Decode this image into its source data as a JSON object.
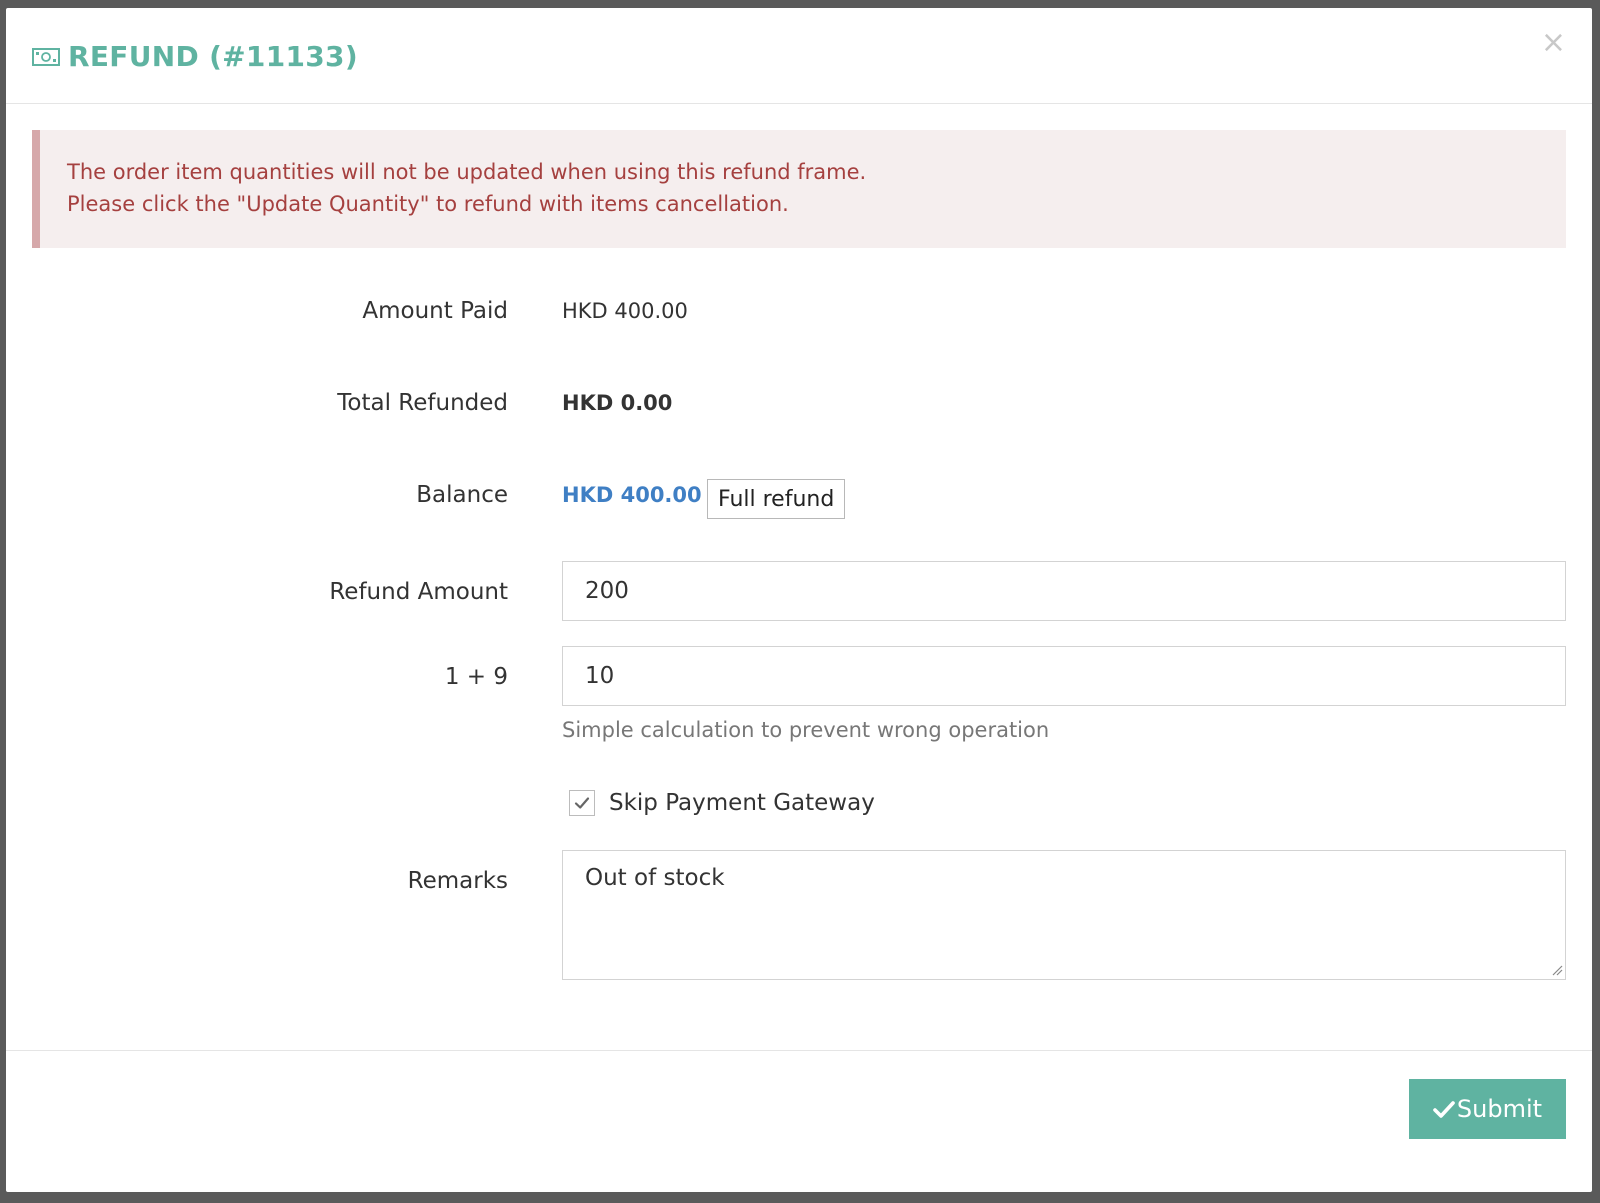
{
  "modal": {
    "title": "REFUND (#11133)",
    "close_label": "×"
  },
  "alert": {
    "line1": "The order item quantities will not be updated when using this refund frame.",
    "line2": "Please click the \"Update Quantity\" to refund with items cancellation."
  },
  "form": {
    "amount_paid": {
      "label": "Amount Paid",
      "value": "HKD 400.00"
    },
    "total_refunded": {
      "label": "Total Refunded",
      "value": "HKD 0.00"
    },
    "balance": {
      "label": "Balance",
      "value": "HKD 400.00",
      "button": "Full refund"
    },
    "refund_amount": {
      "label": "Refund Amount",
      "value": "200"
    },
    "calculation": {
      "label": "1 + 9",
      "value": "10",
      "help": "Simple calculation to prevent wrong operation"
    },
    "skip_gateway": {
      "label": "Skip Payment Gateway",
      "checked": true
    },
    "remarks": {
      "label": "Remarks",
      "value": "Out of stock"
    }
  },
  "footer": {
    "submit_label": "Submit"
  },
  "colors": {
    "accent": "#5fb3a1",
    "alert_text": "#a5403f",
    "alert_bg": "#f5eeee",
    "balance_blue": "#3f7fc4"
  }
}
